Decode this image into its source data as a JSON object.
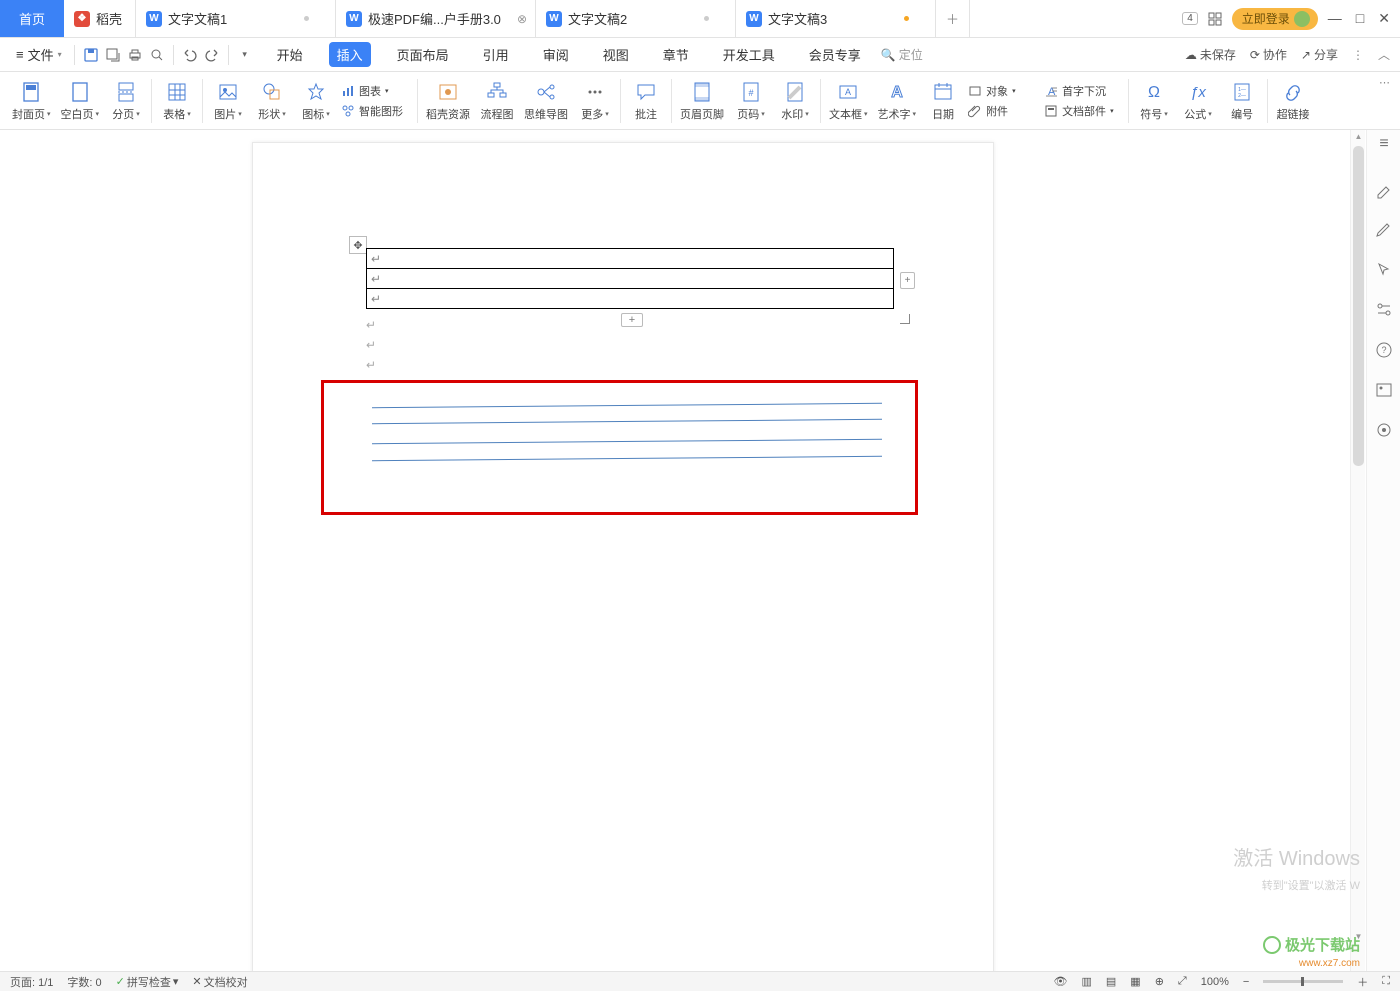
{
  "titlebar": {
    "home": "首页",
    "dk": "稻壳",
    "tabs": [
      {
        "label": "文字文稿1"
      },
      {
        "label": "极速PDF编...户手册3.0"
      },
      {
        "label": "文字文稿2"
      },
      {
        "label": "文字文稿3"
      }
    ],
    "login": "立即登录",
    "badge": "4"
  },
  "menubar": {
    "file": "文件",
    "tabs": [
      "开始",
      "插入",
      "页面布局",
      "引用",
      "审阅",
      "视图",
      "章节",
      "开发工具",
      "会员专享"
    ],
    "search": "定位",
    "right": {
      "unsaved": "未保存",
      "coop": "协作",
      "share": "分享"
    }
  },
  "ribbon": {
    "items": [
      {
        "k": "cover",
        "label": "封面页"
      },
      {
        "k": "blank",
        "label": "空白页"
      },
      {
        "k": "pagebreak",
        "label": "分页"
      },
      {
        "k": "table",
        "label": "表格"
      },
      {
        "k": "picture",
        "label": "图片"
      },
      {
        "k": "shape",
        "label": "形状"
      },
      {
        "k": "icon",
        "label": "图标"
      },
      {
        "k": "chart",
        "label": "图表"
      },
      {
        "k": "smartart",
        "label": "智能图形"
      },
      {
        "k": "dkres",
        "label": "稻壳资源"
      },
      {
        "k": "flowchart",
        "label": "流程图"
      },
      {
        "k": "mindmap",
        "label": "思维导图"
      },
      {
        "k": "more",
        "label": "更多"
      },
      {
        "k": "comment",
        "label": "批注"
      },
      {
        "k": "header",
        "label": "页眉页脚"
      },
      {
        "k": "pageno",
        "label": "页码"
      },
      {
        "k": "watermark",
        "label": "水印"
      },
      {
        "k": "textbox",
        "label": "文本框"
      },
      {
        "k": "wordart",
        "label": "艺术字"
      },
      {
        "k": "date",
        "label": "日期"
      },
      {
        "k": "object",
        "label": "对象"
      },
      {
        "k": "attach",
        "label": "附件"
      },
      {
        "k": "docpart",
        "label": "文档部件"
      },
      {
        "k": "dropcap",
        "label": "首字下沉"
      },
      {
        "k": "symbol",
        "label": "符号"
      },
      {
        "k": "formula",
        "label": "公式"
      },
      {
        "k": "number",
        "label": "编号"
      },
      {
        "k": "hyperlink",
        "label": "超链接"
      }
    ]
  },
  "status": {
    "page": "页面: 1/1",
    "words": "字数: 0",
    "spell": "拼写检查",
    "docproof": "文档校对",
    "zoom": "100%"
  },
  "watermark": {
    "line1": "激活 Windows",
    "line2": "转到\"设置\"以激活 W",
    "brand": "极光下载站",
    "url": "www.xz7.com"
  }
}
